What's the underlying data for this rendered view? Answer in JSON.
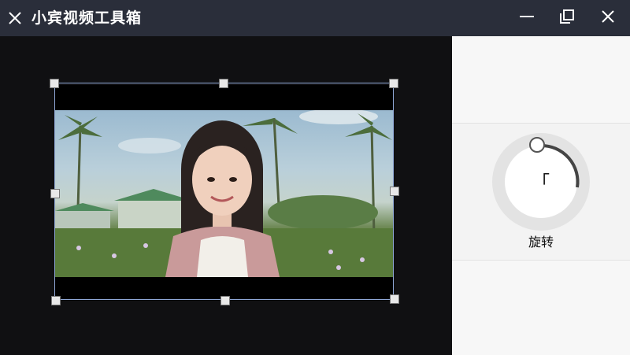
{
  "window": {
    "title": "小宾视频工具箱",
    "controls": [
      "minimize-icon",
      "maximize-icon",
      "close-icon"
    ]
  },
  "preview": {
    "content": "video-frame",
    "colors": {
      "background": "#101012",
      "crop_border": "#8fa7d6",
      "letterbox": "#000000"
    }
  },
  "rotate_panel": {
    "dial_value": "「",
    "label": "旋转"
  },
  "colors": {
    "titlebar": "#2a2e3a",
    "panel": "#f3f3f3"
  }
}
